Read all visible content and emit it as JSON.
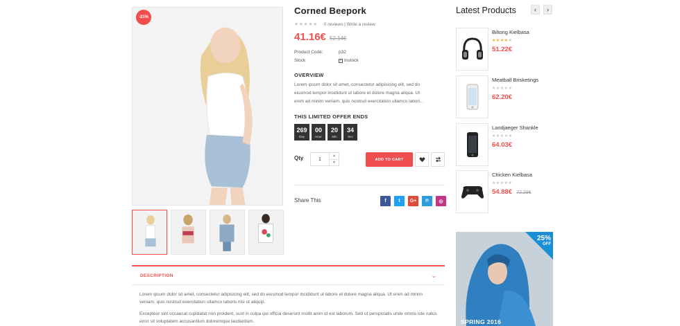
{
  "product": {
    "sale_badge": "-21%",
    "title": "Corned Beepork",
    "reviews": "0 reviews",
    "review_sep": "|",
    "write_review": "Write a review",
    "price": "41.16€",
    "old_price": "52.14€",
    "rating": 0,
    "code_label": "Product Code:",
    "code_value": "p32",
    "stock_label": "Stock",
    "stock_value": "Instock",
    "overview_heading": "OVERVIEW",
    "overview_text": "Lorem ipsum dolor sit amet, consectetur adipisicing elit, sed do eiusmod tempor incididunt ut labore et dolore magna aliqua. Ut enim ad minim veniam, quis nostrud exercitation ullamco labori...",
    "offer_heading": "THIS LIMITED OFFER ENDS",
    "countdown": [
      {
        "value": "269",
        "unit": "Day"
      },
      {
        "value": "00",
        "unit": "Hour"
      },
      {
        "value": "20",
        "unit": "Min"
      },
      {
        "value": "34",
        "unit": "Sec"
      }
    ],
    "qty_label": "Qty",
    "qty_value": "1",
    "add_to_cart": "ADD TO CART",
    "share_label": "Share This",
    "socials": [
      {
        "icon": "facebook-icon",
        "glyph": "f",
        "color": "#3b5998"
      },
      {
        "icon": "twitter-icon",
        "glyph": "t",
        "color": "#1da1f2"
      },
      {
        "icon": "google-plus-icon",
        "glyph": "G+",
        "color": "#dd4b39"
      },
      {
        "icon": "pinterest-icon",
        "glyph": "℗",
        "color": "#2d9cdb"
      },
      {
        "icon": "instagram-icon",
        "glyph": "◎",
        "color": "#c13584"
      }
    ]
  },
  "description": {
    "tab_title": "DESCRIPTION",
    "p1": "Lorem ipsum dolor sit amet, consectetur adipisicing elit, sed do eiusmod tempor incididunt ut labore et dolore magna aliqua. Ut enim ad minim veniam, quis nostrud exercitation ullamco laboris nisi ut aliquip.",
    "p2": "Excepteur sint occaecat cupidatat non proident, sunt in culpa qui officia deserunt mollit anim id est laborum. Sed ut perspiciatis unde omnis iste natus error sit voluptatem accusantium doloremque laudantium."
  },
  "sidebar": {
    "title": "Latest Products",
    "items": [
      {
        "name": "Biltong Kielbasa",
        "price": "51.22€",
        "old_price": "",
        "rating": 4,
        "icon": "headphones-icon"
      },
      {
        "name": "Meatball Brisketings",
        "price": "62.20€",
        "old_price": "",
        "rating": 0,
        "icon": "phone-white-icon"
      },
      {
        "name": "Landjaeger Shankle",
        "price": "64.03€",
        "old_price": "",
        "rating": 0,
        "icon": "phone-black-icon"
      },
      {
        "name": "Chicken Kielbasa",
        "price": "54.88€",
        "old_price": "72.28€",
        "rating": 0,
        "icon": "gamepad-icon"
      }
    ],
    "banner": {
      "percent": "25%",
      "off": "OFF",
      "season": "SPRING 2016"
    }
  },
  "colors": {
    "accent": "#f04e4e",
    "countdown_bg": "#333333"
  }
}
